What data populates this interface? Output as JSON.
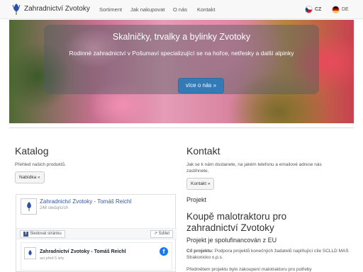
{
  "navbar": {
    "brand": "Zahradnictví Zvotoky",
    "links": [
      "Sortiment",
      "Jak nakupovat",
      "O nás",
      "Kontakt"
    ],
    "lang_cz": "CZ",
    "lang_de": "DE"
  },
  "hero": {
    "title": "Skalničky, trvalky a bylinky Zvotoky",
    "subtitle": "Rodinné zahradnictví v Pošumaví specializující se na hořce, netřesky a další alpinky",
    "button": "více o nás »"
  },
  "katalog": {
    "heading": "Katalog",
    "text": "Přehled našich produktů.",
    "button": "Nabídka »"
  },
  "facebook": {
    "page_name": "Zahradnictví Zvotoky - Tomáš Reichl",
    "followers": "248 sledujících",
    "follow_label": "Sledovat stránku",
    "share_label": "Sdílet",
    "post_name": "Zahradnictví Zvotoky - Tomáš Reichl",
    "post_time": "asi před 5 lety"
  },
  "kontakt": {
    "heading": "Kontakt",
    "text": "Jak se k nám dostanete, na jakém telefonu a emailové adrese nás zastihnete.",
    "button": "Kontakt »"
  },
  "projekt": {
    "label": "Projekt",
    "title": "Koupě malotraktoru pro zahradnictví Zvotoky",
    "subtitle": "Projekt je spolufinancován z EU",
    "goal_label": "Cíl projektu:",
    "goal_text": "Podpora projektů konečných žadatelů naplňující cíle SCLLD MAS Strakonicko o.p.s.",
    "desc": "Předmětem projektu bylo zakoupení malotraktoru pro potřeby"
  },
  "colors": {
    "primary": "#337ab7",
    "fb_blue": "#365899"
  }
}
